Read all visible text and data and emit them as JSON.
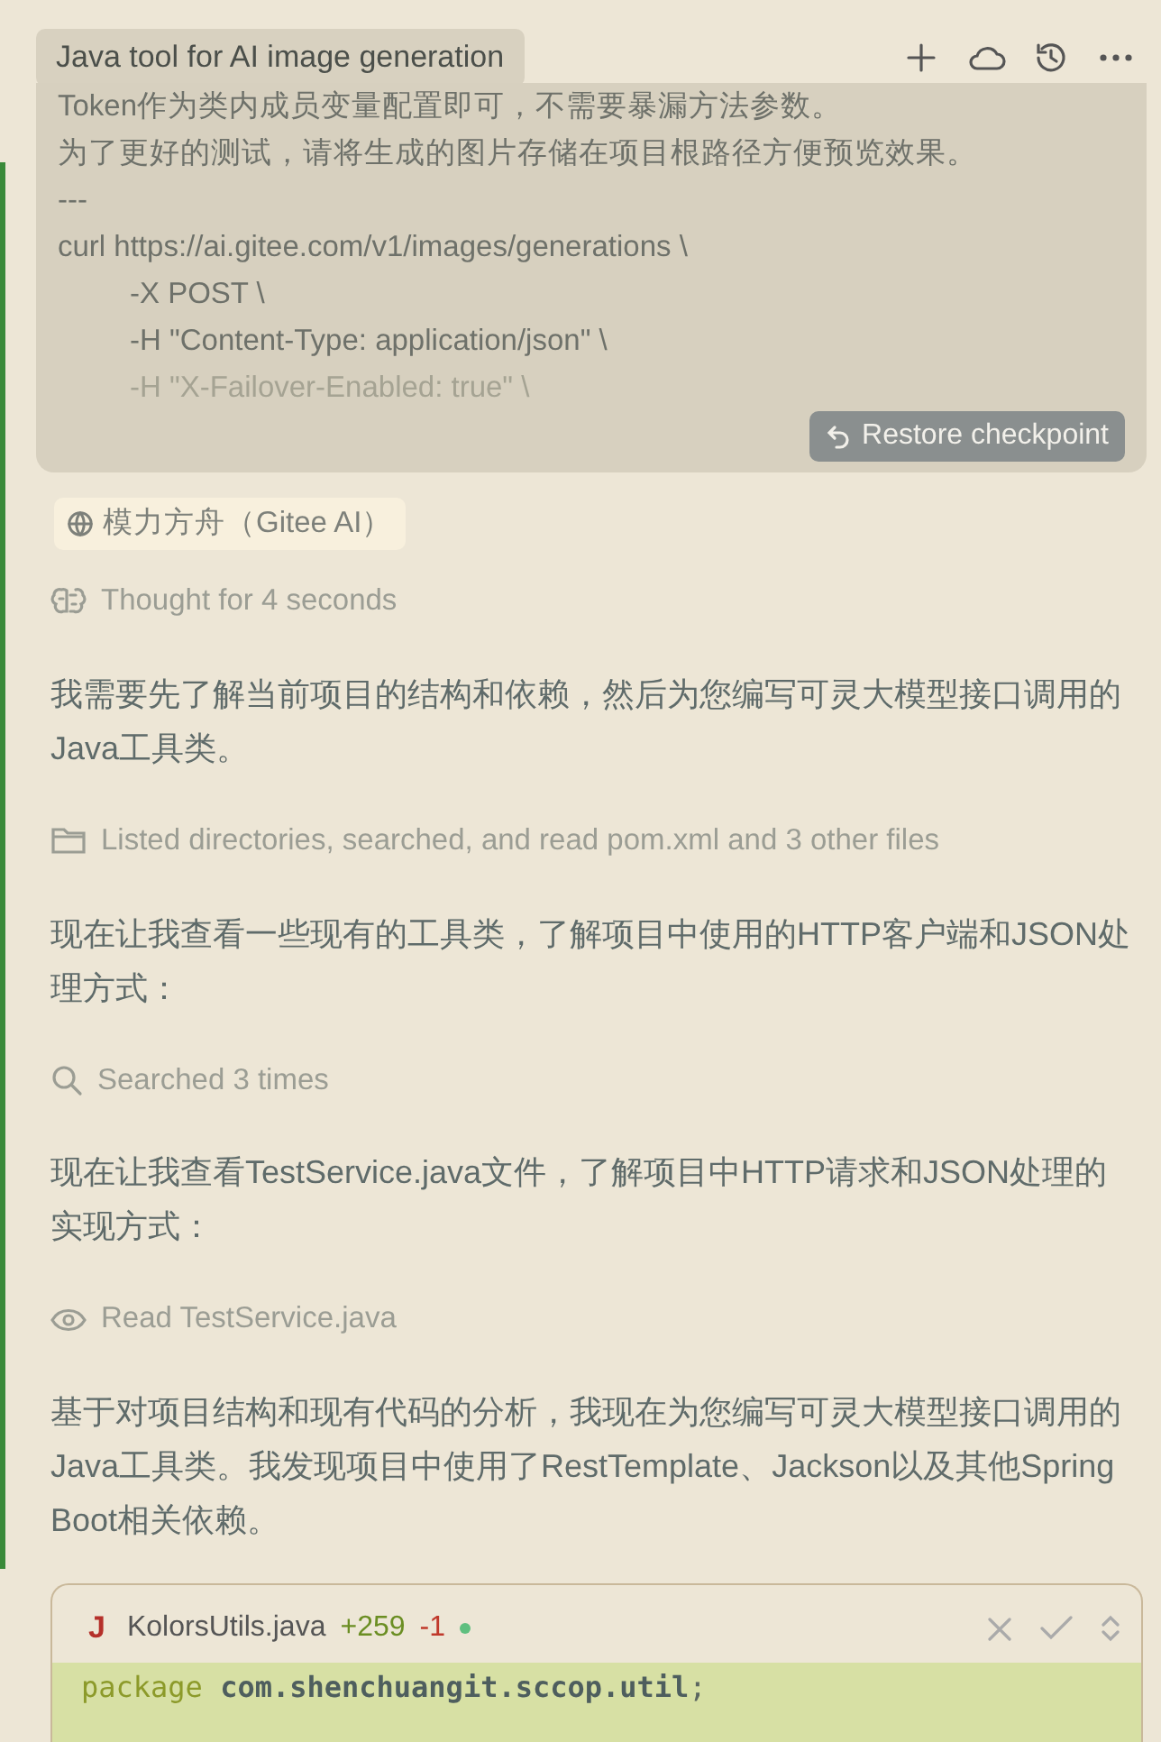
{
  "header": {
    "title": "Java tool for AI image generation",
    "actions": [
      {
        "kind": "plus"
      },
      {
        "kind": "cloud"
      },
      {
        "kind": "history"
      },
      {
        "kind": "more"
      }
    ]
  },
  "prompt": {
    "lines": [
      {
        "text": "Token作为类内成员变量配置即可，不需要暴漏方法参数。",
        "indent": false,
        "faded": false
      },
      {
        "text": "为了更好的测试，请将生成的图片存储在项目根路径方便预览效果。",
        "indent": false,
        "faded": false
      },
      {
        "text": "---",
        "indent": false,
        "faded": false
      },
      {
        "text": "curl https://ai.gitee.com/v1/images/generations \\",
        "indent": false,
        "faded": false
      },
      {
        "text": "-X POST \\",
        "indent": true,
        "faded": false
      },
      {
        "text": "-H \"Content-Type: application/json\" \\",
        "indent": true,
        "faded": false
      },
      {
        "text": "-H \"X-Failover-Enabled: true\" \\",
        "indent": true,
        "faded": true
      }
    ],
    "restore_button": "Restore checkpoint"
  },
  "context_chip": "模力方舟（Gitee AI）",
  "steps": [
    {
      "kind": "thought",
      "text": "Thought for 4 seconds"
    },
    {
      "kind": "message",
      "text": "我需要先了解当前项目的结构和依赖，然后为您编写可灵大模型接口调用的Java工具类。"
    },
    {
      "kind": "listed",
      "text": "Listed directories, searched, and read pom.xml and 3 other files"
    },
    {
      "kind": "message",
      "text": "现在让我查看一些现有的工具类，了解项目中使用的HTTP客户端和JSON处理方式："
    },
    {
      "kind": "search",
      "text": "Searched 3 times"
    },
    {
      "kind": "message",
      "text": "现在让我查看TestService.java文件，了解项目中HTTP请求和JSON处理的实现方式："
    },
    {
      "kind": "read",
      "text": "Read TestService.java"
    },
    {
      "kind": "message",
      "text": "基于对项目结构和现有代码的分析，我现在为您编写可灵大模型接口调用的Java工具类。我发现项目中使用了RestTemplate、Jackson以及其他Spring Boot相关依赖。"
    }
  ],
  "file_card": {
    "file_icon": "J",
    "file_name": "KolorsUtils.java",
    "added": "+259",
    "removed": "-1",
    "unsaved": true,
    "code": [
      {
        "keyword": "package",
        "rest": "com.shenchuangit.sccop.util",
        "punct": ";"
      }
    ]
  }
}
